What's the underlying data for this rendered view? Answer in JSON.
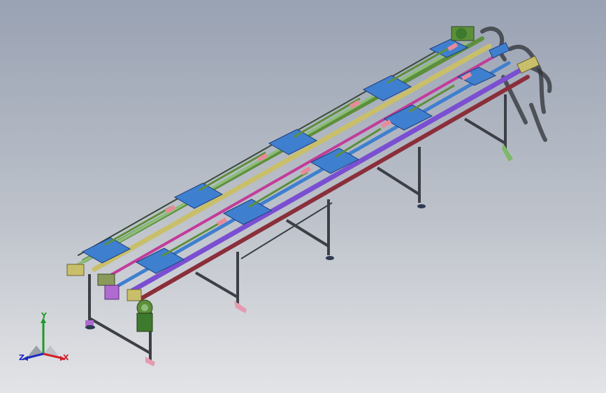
{
  "viewport": {
    "background_top": "#99a2b3",
    "background_bottom": "#e3e4e7"
  },
  "model": {
    "description_icon": "conveyor-assembly",
    "colors": {
      "frame_dark": "#3c3f45",
      "rail_purple": "#7a4fd1",
      "rail_magenta": "#c23c9a",
      "rail_khaki": "#c9bf6a",
      "carriage_blue": "#3f7fcf",
      "carriage_green": "#5d8f3a",
      "accent_pink": "#e98a9a",
      "rail_red": "#8a2f3a",
      "shadow": "#3a3a3a"
    }
  },
  "triad": {
    "label_x": "X",
    "label_y": "Y",
    "label_z": "Z",
    "color_x": "#d4202a",
    "color_y": "#1f9a2a",
    "color_z": "#1d2bc0"
  }
}
